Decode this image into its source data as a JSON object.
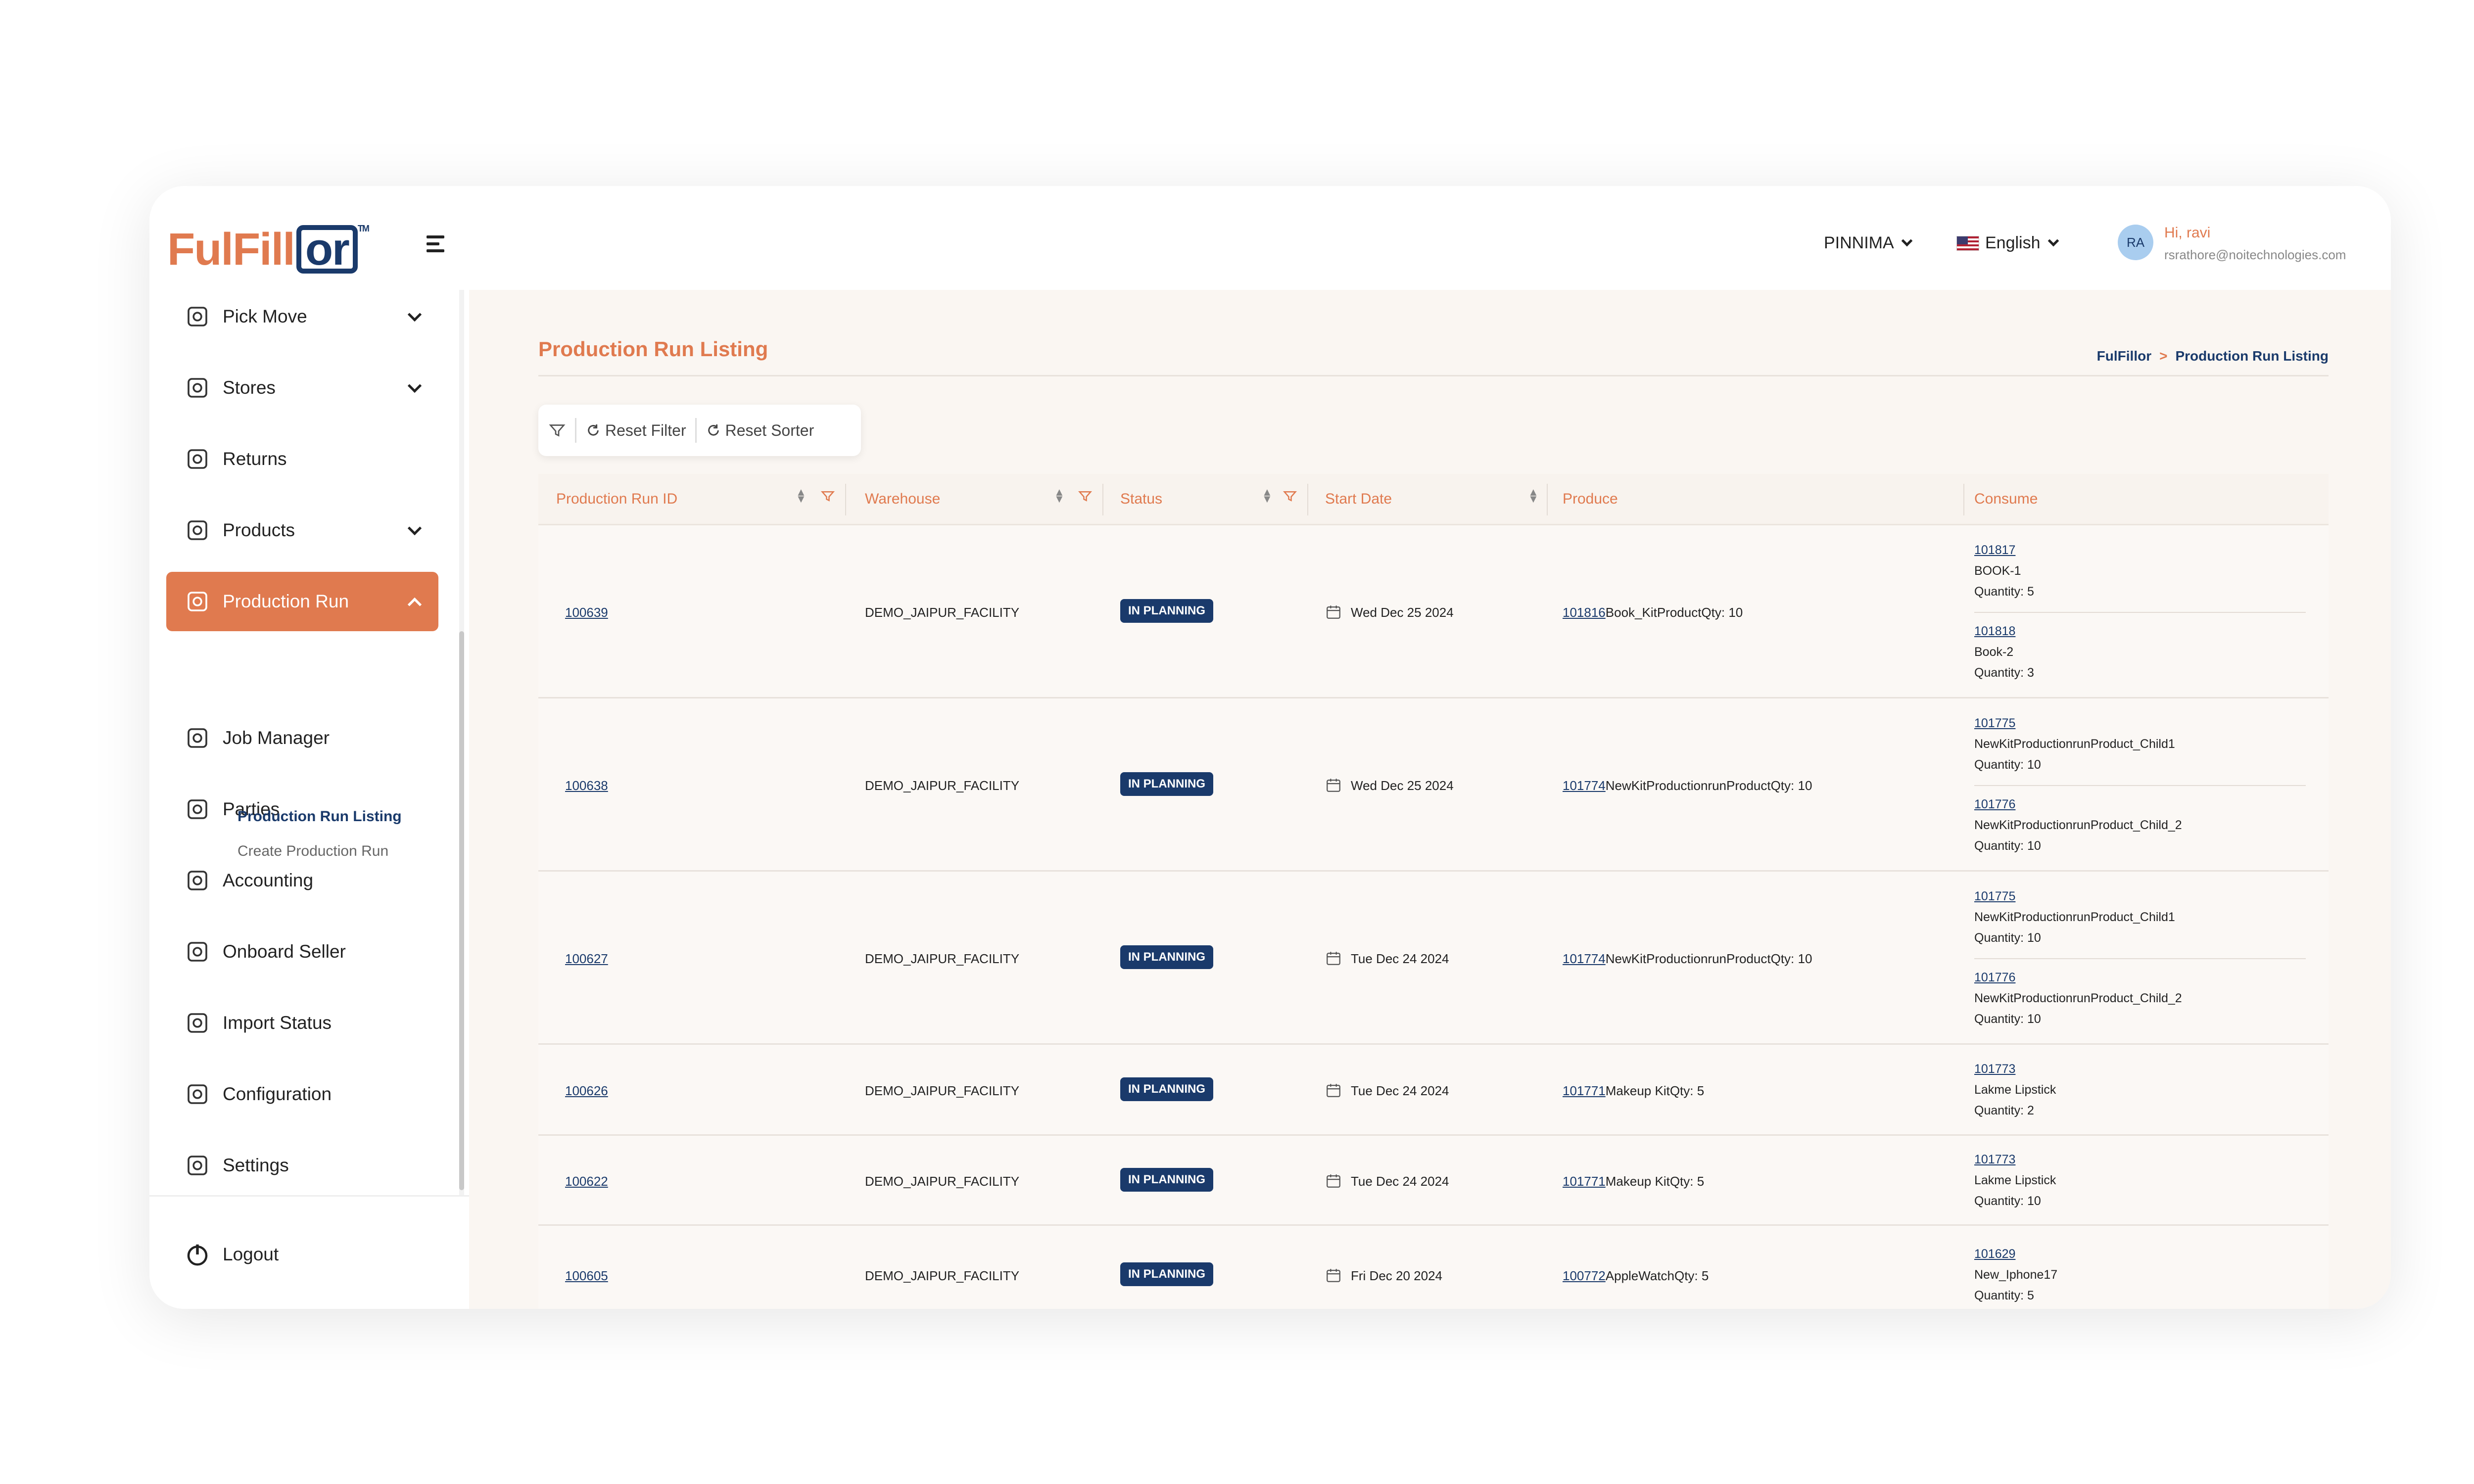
{
  "brand": {
    "logo_part1": "FulFill",
    "logo_part2": "or",
    "tm": "TM"
  },
  "header": {
    "tenant": "PINNIMA",
    "language": "English",
    "avatar_initials": "RA",
    "greeting": "Hi, ravi",
    "email": "rsrathore@noitechnologies.com"
  },
  "sidebar": {
    "items": [
      {
        "label": "Pick Move",
        "icon": "pick-move-icon",
        "expandable": true
      },
      {
        "label": "Stores",
        "icon": "stores-icon",
        "expandable": true
      },
      {
        "label": "Returns",
        "icon": "returns-icon",
        "expandable": false
      },
      {
        "label": "Products",
        "icon": "products-icon",
        "expandable": true
      },
      {
        "label": "Production Run",
        "icon": "production-run-icon",
        "expandable": true,
        "active": true
      },
      {
        "label": "Job Manager",
        "icon": "job-manager-icon",
        "expandable": false
      },
      {
        "label": "Parties",
        "icon": "parties-icon",
        "expandable": false
      },
      {
        "label": "Accounting",
        "icon": "accounting-icon",
        "expandable": false
      },
      {
        "label": "Onboard Seller",
        "icon": "onboard-seller-icon",
        "expandable": false
      },
      {
        "label": "Import Status",
        "icon": "import-status-icon",
        "expandable": false
      },
      {
        "label": "Configuration",
        "icon": "configuration-icon",
        "expandable": false
      },
      {
        "label": "Settings",
        "icon": "settings-icon",
        "expandable": false
      }
    ],
    "sub_items": [
      "Production Run Listing",
      "Create Production Run"
    ],
    "logout": "Logout"
  },
  "page": {
    "title": "Production Run Listing",
    "breadcrumb": [
      "FulFillor",
      ">",
      "Production Run Listing"
    ]
  },
  "toolbar": {
    "reset_filter": "Reset Filter",
    "reset_sorter": "Reset Sorter"
  },
  "table": {
    "columns": [
      "Production Run ID",
      "Warehouse",
      "Status",
      "Start Date",
      "Produce",
      "Consume"
    ],
    "rows": [
      {
        "id": "100639",
        "warehouse": "DEMO_JAIPUR_FACILITY",
        "status": "IN PLANNING",
        "date": "Wed Dec 25 2024",
        "produce_id": "101816",
        "produce_text": "Book_KitProductQty: 10",
        "consume": [
          {
            "id": "101817",
            "name": "BOOK-1",
            "qty": "Quantity: 5"
          },
          {
            "id": "101818",
            "name": "Book-2",
            "qty": "Quantity: 3"
          }
        ]
      },
      {
        "id": "100638",
        "warehouse": "DEMO_JAIPUR_FACILITY",
        "status": "IN PLANNING",
        "date": "Wed Dec 25 2024",
        "produce_id": "101774",
        "produce_text": "NewKitProductionrunProductQty: 10",
        "consume": [
          {
            "id": "101775",
            "name": "NewKitProductionrunProduct_Child1",
            "qty": "Quantity: 10"
          },
          {
            "id": "101776",
            "name": "NewKitProductionrunProduct_Child_2",
            "qty": "Quantity: 10"
          }
        ]
      },
      {
        "id": "100627",
        "warehouse": "DEMO_JAIPUR_FACILITY",
        "status": "IN PLANNING",
        "date": "Tue Dec 24 2024",
        "produce_id": "101774",
        "produce_text": "NewKitProductionrunProductQty: 10",
        "consume": [
          {
            "id": "101775",
            "name": "NewKitProductionrunProduct_Child1",
            "qty": "Quantity: 10"
          },
          {
            "id": "101776",
            "name": "NewKitProductionrunProduct_Child_2",
            "qty": "Quantity: 10"
          }
        ]
      },
      {
        "id": "100626",
        "warehouse": "DEMO_JAIPUR_FACILITY",
        "status": "IN PLANNING",
        "date": "Tue Dec 24 2024",
        "produce_id": "101771",
        "produce_text": "Makeup KitQty: 5",
        "consume": [
          {
            "id": "101773",
            "name": "Lakme Lipstick",
            "qty": "Quantity: 2"
          }
        ]
      },
      {
        "id": "100622",
        "warehouse": "DEMO_JAIPUR_FACILITY",
        "status": "IN PLANNING",
        "date": "Tue Dec 24 2024",
        "produce_id": "101771",
        "produce_text": "Makeup KitQty: 5",
        "consume": [
          {
            "id": "101773",
            "name": "Lakme Lipstick",
            "qty": "Quantity: 10"
          }
        ]
      },
      {
        "id": "100605",
        "warehouse": "DEMO_JAIPUR_FACILITY",
        "status": "IN PLANNING",
        "date": "Fri Dec 20 2024",
        "produce_id": "100772",
        "produce_text": "AppleWatchQty: 5",
        "consume": [
          {
            "id": "101629",
            "name": "New_Iphone17",
            "qty": "Quantity: 5"
          }
        ]
      }
    ]
  },
  "colors": {
    "accent": "#e07a4f",
    "navy": "#1a3a6b",
    "background": "#faf6f2"
  }
}
